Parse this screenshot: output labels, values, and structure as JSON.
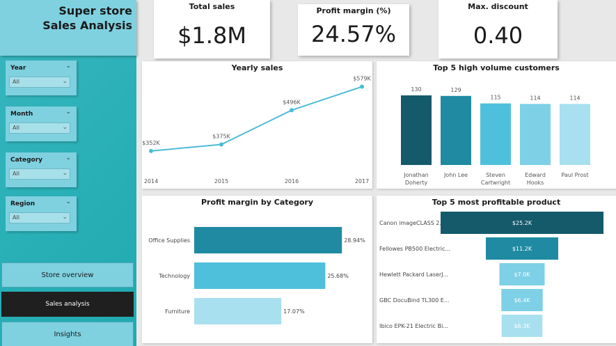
{
  "header": {
    "title_line1": "Super store",
    "title_line2": "Sales Analysis"
  },
  "slicers": [
    {
      "label": "Year",
      "value": "All"
    },
    {
      "label": "Month",
      "value": "All"
    },
    {
      "label": "Category",
      "value": "All"
    },
    {
      "label": "Region",
      "value": "All"
    }
  ],
  "nav": [
    {
      "label": "Store overview",
      "active": false
    },
    {
      "label": "Sales analysis",
      "active": true
    },
    {
      "label": "Insights",
      "active": false
    }
  ],
  "kpis": [
    {
      "title": "Total sales",
      "value": "$1.8M"
    },
    {
      "title": "Profit margin (%)",
      "value": "24.57%"
    },
    {
      "title": "Max. discount",
      "value": "0.40"
    }
  ],
  "colors": {
    "line": "#4bbcd6",
    "bar_palette": [
      "#145a6b",
      "#1f8aa2",
      "#4ec0dc",
      "#7dd0e6",
      "#a8e0ef"
    ]
  },
  "chart_data": [
    {
      "id": "yearly",
      "type": "line",
      "title": "Yearly sales",
      "x": [
        "2014",
        "2015",
        "2016",
        "2017"
      ],
      "values": [
        352,
        375,
        496,
        579
      ],
      "data_labels": [
        "$352K",
        "$375K",
        "$496K",
        "$579K"
      ],
      "ylim": [
        300,
        600
      ],
      "grid": false
    },
    {
      "id": "customers",
      "type": "bar",
      "title": "Top 5 high volume customers",
      "categories": [
        [
          "Jonathan",
          "Doherty"
        ],
        [
          "John Lee"
        ],
        [
          "Steven",
          "Cartwright"
        ],
        [
          "Edward",
          "Hooks"
        ],
        [
          "Paul Prost"
        ]
      ],
      "values": [
        130,
        129,
        115,
        114,
        114
      ],
      "ylim": [
        0,
        130
      ]
    },
    {
      "id": "margin",
      "type": "bar",
      "orientation": "horizontal",
      "title": "Profit margin by Category",
      "categories": [
        "Office Supplies",
        "Technology",
        "Furniture"
      ],
      "values": [
        28.94,
        25.68,
        17.07
      ],
      "data_labels": [
        "28.94%",
        "25.68%",
        "17.07%"
      ],
      "xlim": [
        0,
        30
      ]
    },
    {
      "id": "products",
      "type": "bar",
      "orientation": "funnel",
      "title": "Top 5 most profitable product",
      "categories": [
        "Canon imageCLASS 2...",
        "Fellowes PB500 Electric...",
        "Hewlett Packard LaserJ...",
        "GBC DocuBind TL300 E...",
        "Ibico EPK-21 Electric Bi..."
      ],
      "values": [
        25.2,
        11.2,
        7.0,
        6.4,
        6.3
      ],
      "data_labels": [
        "$25.2K",
        "$11.2K",
        "$7.0K",
        "$6.4K",
        "$6.3K"
      ]
    }
  ]
}
